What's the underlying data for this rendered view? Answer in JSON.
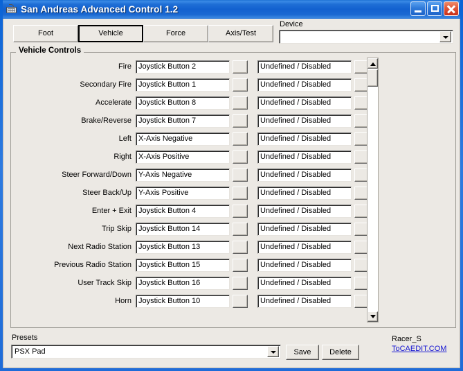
{
  "window": {
    "title": "San Andreas Advanced Control 1.2",
    "icon": "keyboard-icon",
    "buttons": {
      "minimize": "minimize-icon",
      "maximize": "maximize-icon",
      "close": "close-icon"
    },
    "colors": {
      "titlebar_blue": "#1361cf",
      "client_face": "#ece9e4",
      "close_red": "#c8301a",
      "link_blue": "#1414d2"
    }
  },
  "tabs": [
    {
      "label": "Foot",
      "active": false
    },
    {
      "label": "Vehicle",
      "active": true
    },
    {
      "label": "Force",
      "active": false
    },
    {
      "label": "Axis/Test",
      "active": false
    }
  ],
  "device": {
    "label": "Device",
    "value": "",
    "placeholder": ""
  },
  "controls_group": {
    "legend": "Vehicle Controls",
    "rows": [
      {
        "label": "Fire",
        "primary": "Joystick Button 2",
        "secondary": "Undefined / Disabled"
      },
      {
        "label": "Secondary Fire",
        "primary": "Joystick Button 1",
        "secondary": "Undefined / Disabled"
      },
      {
        "label": "Accelerate",
        "primary": "Joystick Button 8",
        "secondary": "Undefined / Disabled"
      },
      {
        "label": "Brake/Reverse",
        "primary": "Joystick Button 7",
        "secondary": "Undefined / Disabled"
      },
      {
        "label": "Left",
        "primary": "X-Axis Negative",
        "secondary": "Undefined / Disabled"
      },
      {
        "label": "Right",
        "primary": "X-Axis Positive",
        "secondary": "Undefined / Disabled"
      },
      {
        "label": "Steer Forward/Down",
        "primary": "Y-Axis Negative",
        "secondary": "Undefined / Disabled"
      },
      {
        "label": "Steer Back/Up",
        "primary": "Y-Axis Positive",
        "secondary": "Undefined / Disabled"
      },
      {
        "label": "Enter + Exit",
        "primary": "Joystick Button 4",
        "secondary": "Undefined / Disabled"
      },
      {
        "label": "Trip Skip",
        "primary": "Joystick Button 14",
        "secondary": "Undefined / Disabled"
      },
      {
        "label": "Next Radio Station",
        "primary": "Joystick Button 13",
        "secondary": "Undefined / Disabled"
      },
      {
        "label": "Previous Radio Station",
        "primary": "Joystick Button 15",
        "secondary": "Undefined / Disabled"
      },
      {
        "label": "User Track Skip",
        "primary": "Joystick Button 16",
        "secondary": "Undefined / Disabled"
      },
      {
        "label": "Horn",
        "primary": "Joystick Button 10",
        "secondary": "Undefined / Disabled"
      }
    ]
  },
  "scrollbar": {
    "up_arrow": "scroll-up-icon",
    "down_arrow": "scroll-down-icon"
  },
  "presets": {
    "label": "Presets",
    "value": "PSX Pad",
    "save_label": "Save",
    "delete_label": "Delete"
  },
  "credits": {
    "name": "Racer_S",
    "link": "ToCAEDIT.COM"
  }
}
